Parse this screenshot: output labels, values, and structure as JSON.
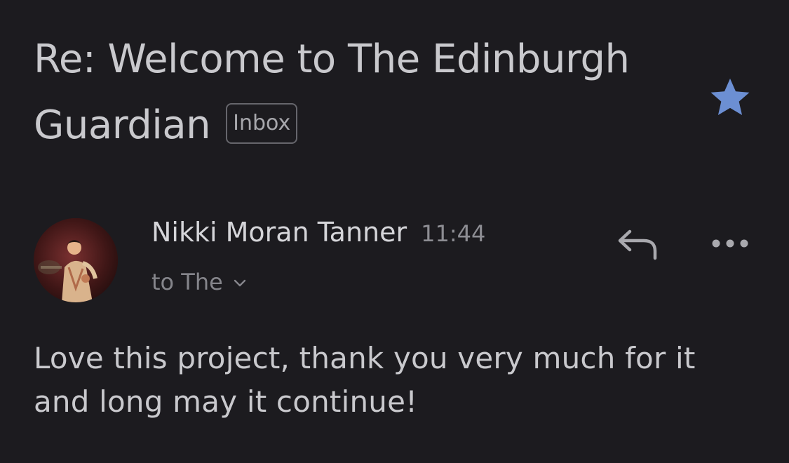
{
  "email": {
    "subject": "Re: Welcome to The Edinburgh Guardian",
    "label_badge": "Inbox",
    "starred": true,
    "sender_name": "Nikki Moran Tanner",
    "time": "11:44",
    "recipient_line": "to The",
    "body": "Love this project, thank you very much for it and long may it continue!"
  },
  "icons": {
    "star": "star-icon",
    "reply": "reply-icon",
    "more": "more-options-icon",
    "expand": "chevron-down-icon"
  },
  "colors": {
    "background": "#1c1b1f",
    "star": "#6c8fd3",
    "text_primary": "#c9c9cd",
    "text_secondary": "#85858b"
  }
}
